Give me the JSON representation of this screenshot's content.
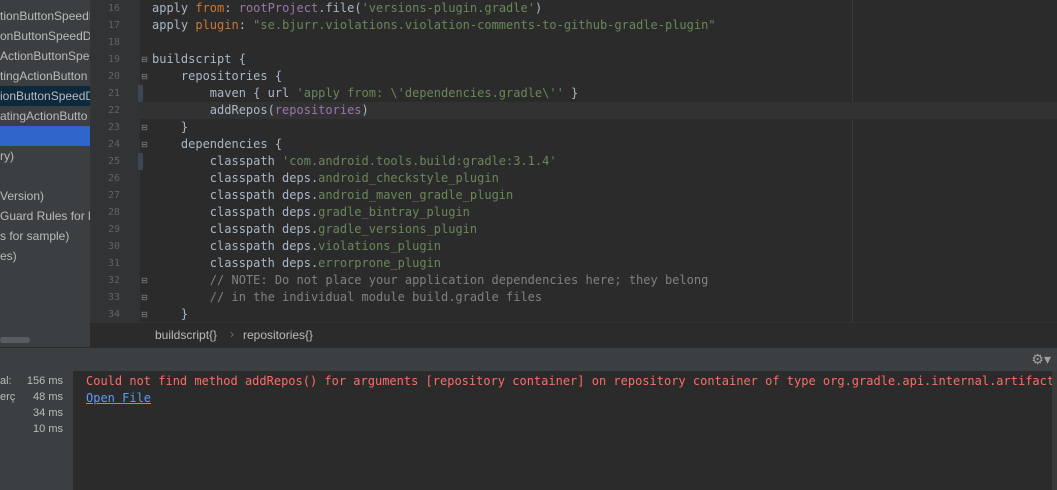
{
  "tree": {
    "rows": [
      "tionButtonSpeedD",
      "onButtonSpeedDi",
      "ActionButtonSpe",
      "tingActionButton",
      "ionButtonSpeedD",
      "atingActionButto",
      "",
      "ry)",
      "",
      "Version)",
      "Guard Rules for li",
      "s for sample)",
      "es)"
    ]
  },
  "editor": {
    "lines": [
      {
        "n": "16",
        "parts": [
          [
            "plain",
            "apply "
          ],
          [
            "kw",
            "from"
          ],
          [
            "plain",
            ": "
          ],
          [
            "prop",
            "rootProject"
          ],
          [
            "plain",
            ".file("
          ],
          [
            "str",
            "'versions-plugin.gradle'"
          ],
          [
            "plain",
            ")"
          ]
        ]
      },
      {
        "n": "17",
        "parts": [
          [
            "plain",
            "apply "
          ],
          [
            "kw",
            "plugin"
          ],
          [
            "plain",
            ": "
          ],
          [
            "str",
            "\"se.bjurr.violations.violation-comments-to-github-gradle-plugin\""
          ]
        ]
      },
      {
        "n": "18",
        "parts": []
      },
      {
        "n": "19",
        "parts": [
          [
            "plain",
            "buildscript {"
          ]
        ]
      },
      {
        "n": "20",
        "parts": [
          [
            "plain",
            "    repositories {"
          ]
        ]
      },
      {
        "n": "21",
        "parts": [
          [
            "plain",
            "        maven { url "
          ],
          [
            "str",
            "'apply from: \\'dependencies.gradle\\''"
          ],
          [
            "plain",
            " }"
          ]
        ]
      },
      {
        "n": "22",
        "parts": [
          [
            "plain",
            "        addRepos("
          ],
          [
            "prop",
            "repositories"
          ],
          [
            "plain",
            ")"
          ]
        ]
      },
      {
        "n": "23",
        "parts": [
          [
            "plain",
            "    }"
          ]
        ]
      },
      {
        "n": "24",
        "parts": [
          [
            "plain",
            "    dependencies {"
          ]
        ]
      },
      {
        "n": "25",
        "parts": [
          [
            "plain",
            "        classpath "
          ],
          [
            "str",
            "'com.android.tools.build:gradle:3.1.4'"
          ]
        ]
      },
      {
        "n": "26",
        "parts": [
          [
            "plain",
            "        classpath deps."
          ],
          [
            "fld",
            "android_checkstyle_plugin"
          ]
        ]
      },
      {
        "n": "27",
        "parts": [
          [
            "plain",
            "        classpath deps."
          ],
          [
            "fld",
            "android_maven_gradle_plugin"
          ]
        ]
      },
      {
        "n": "28",
        "parts": [
          [
            "plain",
            "        classpath deps."
          ],
          [
            "fld",
            "gradle_bintray_plugin"
          ]
        ]
      },
      {
        "n": "29",
        "parts": [
          [
            "plain",
            "        classpath deps."
          ],
          [
            "fld",
            "gradle_versions_plugin"
          ]
        ]
      },
      {
        "n": "30",
        "parts": [
          [
            "plain",
            "        classpath deps."
          ],
          [
            "fld",
            "violations_plugin"
          ]
        ]
      },
      {
        "n": "31",
        "parts": [
          [
            "plain",
            "        classpath deps."
          ],
          [
            "fld",
            "errorprone_plugin"
          ]
        ]
      },
      {
        "n": "32",
        "parts": [
          [
            "com",
            "        // NOTE: Do not place your application dependencies here; they belong"
          ]
        ]
      },
      {
        "n": "33",
        "parts": [
          [
            "com",
            "        // in the individual module build.gradle files"
          ]
        ]
      },
      {
        "n": "34",
        "parts": [
          [
            "plain",
            "    }"
          ]
        ]
      }
    ]
  },
  "breadcrumb": {
    "items": [
      "buildscript{}",
      "repositories{}"
    ],
    "separator": "›"
  },
  "build": {
    "rows": [
      {
        "label": "al:",
        "time": "156 ms"
      },
      {
        "label": "erç",
        "time": "48 ms"
      },
      {
        "label": "",
        "time": "34 ms"
      },
      {
        "label": "",
        "time": "10 ms"
      }
    ],
    "error": "Could not find method addRepos() for arguments [repository container] on repository container of type org.gradle.api.internal.artifacts.ds",
    "open_file": "Open File",
    "settings_icon": "gear-icon"
  }
}
